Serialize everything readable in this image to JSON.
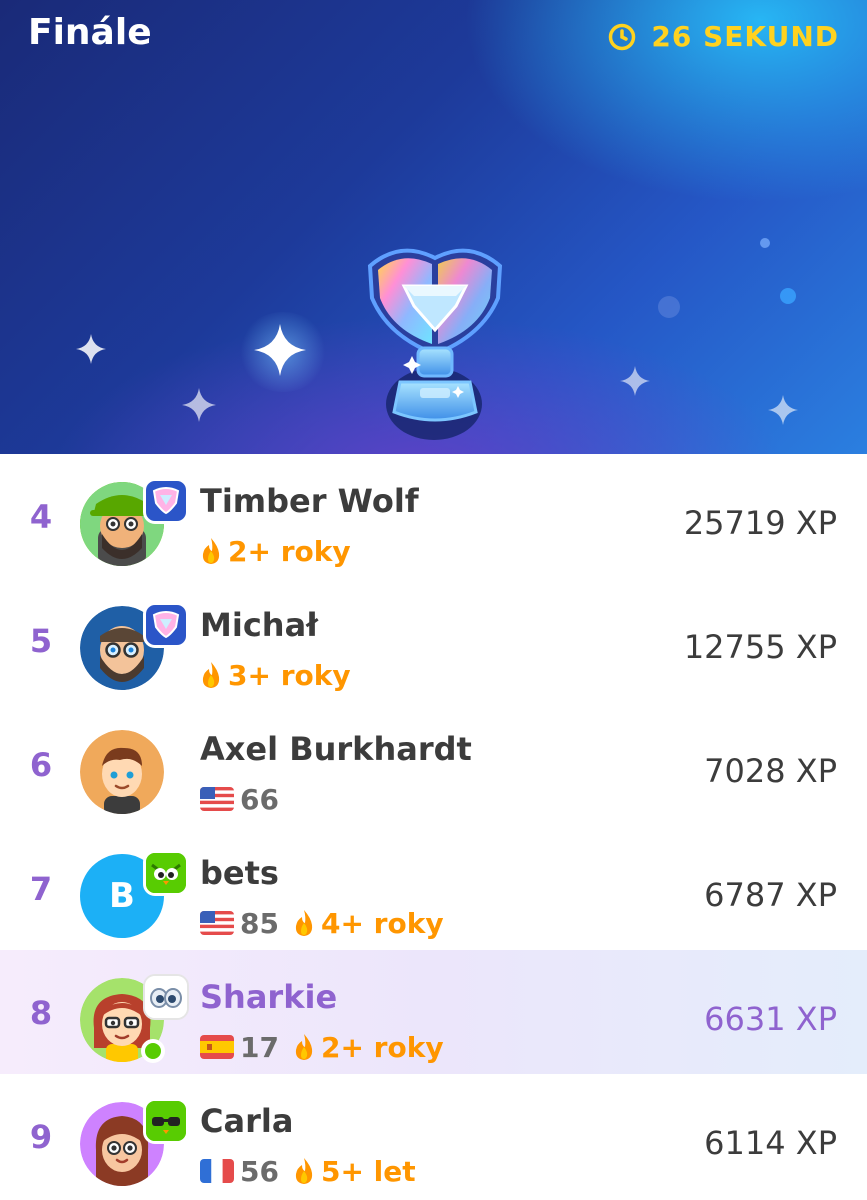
{
  "header": {
    "title": "Finále",
    "timer_text": "26 SEKUND"
  },
  "colors": {
    "accent_purple": "#8f63cf",
    "timer_yellow": "#ffd21f",
    "streak_orange": "#ff9600",
    "online_green": "#58cc02"
  },
  "rows": [
    {
      "rank": "4",
      "name": "Timber Wolf",
      "streak": "2+ roky",
      "xp": "25719 XP"
    },
    {
      "rank": "5",
      "name": "Michał",
      "streak": "3+ roky",
      "xp": "12755 XP"
    },
    {
      "rank": "6",
      "name": "Axel Burkhardt",
      "flag_count": "66",
      "xp": "7028 XP"
    },
    {
      "rank": "7",
      "avatar_letter": "B",
      "name": "bets",
      "flag_count": "85",
      "streak": "4+ roky",
      "xp": "6787 XP"
    },
    {
      "rank": "8",
      "name": "Sharkie",
      "flag_count": "17",
      "streak": "2+ roky",
      "xp": "6631 XP"
    },
    {
      "rank": "9",
      "name": "Carla",
      "flag_count": "56",
      "streak": "5+ let",
      "xp": "6114 XP"
    }
  ]
}
